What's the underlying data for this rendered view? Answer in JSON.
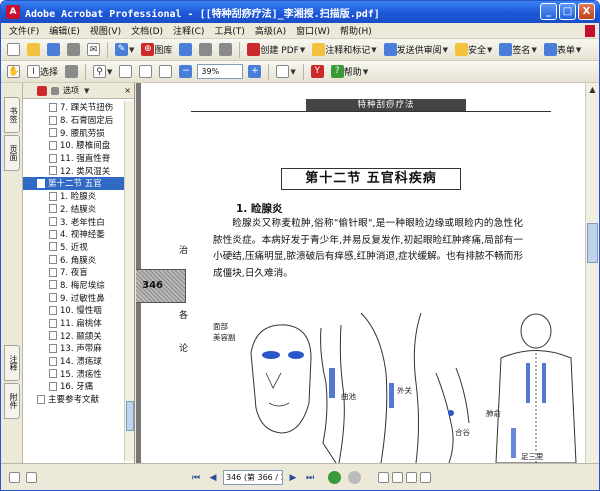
{
  "window": {
    "title": "Adobe Acrobat Professional - [[特种刮痧疗法]_李湘授.扫描版.pdf]",
    "controls": {
      "minimize": "_",
      "maximize": "□",
      "close": "X"
    }
  },
  "menu": {
    "items": [
      "文件(F)",
      "编辑(E)",
      "视图(V)",
      "文档(D)",
      "注释(C)",
      "工具(T)",
      "高级(A)",
      "窗口(W)",
      "帮助(H)"
    ]
  },
  "toolbar1": {
    "organize_label": "图库",
    "create_pdf_label": "创建 PDF",
    "review_label": "注释和标记",
    "send_label": "发送供审阅",
    "secure_label": "安全",
    "sign_label": "签名",
    "forms_label": "表单"
  },
  "toolbar2": {
    "select_label": "选择",
    "zoom_value": "39%",
    "help_label": "帮助"
  },
  "rail": {
    "tabs": [
      "书签",
      "页面",
      "注释",
      "附件"
    ]
  },
  "bookmarks": {
    "options_label": "选项",
    "items": [
      {
        "text": "7.  踝关节扭伤",
        "type": "item"
      },
      {
        "text": "8.  石膏固定后",
        "type": "item"
      },
      {
        "text": "9.  腰肌劳损",
        "type": "item"
      },
      {
        "text": "10.  腰椎间盘",
        "type": "item"
      },
      {
        "text": "11.  强直性脊",
        "type": "item"
      },
      {
        "text": "12.  类风湿关",
        "type": "item"
      },
      {
        "text": "第十二节  五官",
        "type": "section-selected"
      },
      {
        "text": "1.  睑腺炎",
        "type": "item"
      },
      {
        "text": "2.  结膜炎",
        "type": "item"
      },
      {
        "text": "3.  老年性白",
        "type": "item"
      },
      {
        "text": "4.  视神经萎",
        "type": "item"
      },
      {
        "text": "5.  近视",
        "type": "item"
      },
      {
        "text": "6.  角膜炎",
        "type": "item"
      },
      {
        "text": "7.  夜盲",
        "type": "item"
      },
      {
        "text": "8.  梅尼埃综",
        "type": "item"
      },
      {
        "text": "9.  过敏性鼻",
        "type": "item"
      },
      {
        "text": "10.  慢性咽",
        "type": "item"
      },
      {
        "text": "11.  扁桃体",
        "type": "item"
      },
      {
        "text": "12.  颞颌关",
        "type": "item"
      },
      {
        "text": "13.  声带麻",
        "type": "item"
      },
      {
        "text": "14.  溃疡球",
        "type": "item"
      },
      {
        "text": "15.  溃疡性",
        "type": "item"
      },
      {
        "text": "16.  牙痛",
        "type": "item"
      },
      {
        "text": "主要参考文献",
        "type": "section"
      }
    ]
  },
  "page": {
    "running_header": "特种刮痧疗法",
    "section_title": "第十二节  五官科疾病",
    "sub_title": "1. 睑腺炎",
    "paragraph": "睑腺炎又称麦粒肿,俗称\"偷针眼\",是一种眼睑边缘或眼睑内的急性化脓性炎症。本病好发于青少年,并易反复发作,初起眼睑红肿疼痛,局部有一小硬结,压痛明显,脓溃破后有痒感,红肿消退,症状缓解。也有排脓不畅而形成僵块,日久难消。",
    "prev_page_number": "346",
    "edge_chars": [
      "治",
      "各",
      "论"
    ],
    "figure_labels": {
      "face_area": "面部\n美容副",
      "arm": "曲池",
      "waist": "外关",
      "hand": "合谷",
      "back": "肺俞",
      "leg": "足三里"
    }
  },
  "status": {
    "page_field": "346 (第 366 / 389 页)"
  }
}
